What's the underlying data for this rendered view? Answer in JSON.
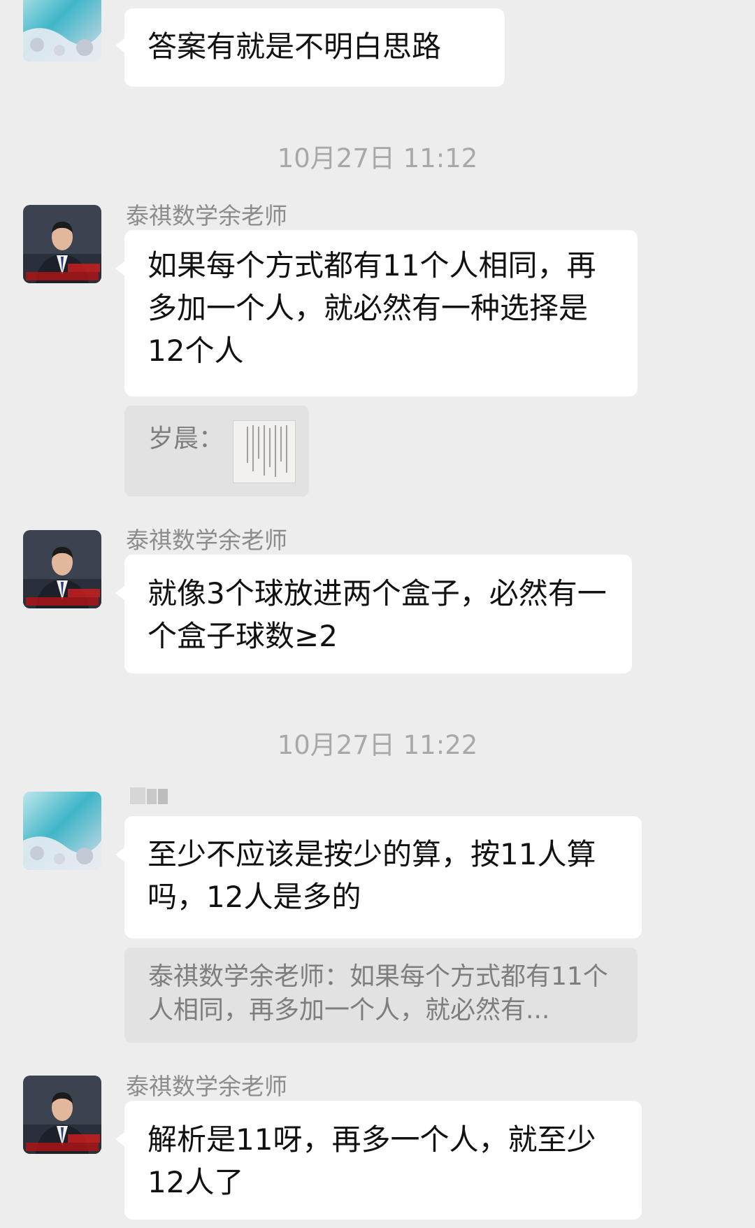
{
  "messages": [
    {
      "text": "答案有就是不明白思路"
    },
    {
      "timestamp": "10月27日 11:12"
    },
    {
      "sender": "泰祺数学余老师",
      "text": "如果每个方式都有11个人相同，再多加一个人，就必然有一种选择是12个人"
    },
    {
      "quote_label": "岁晨："
    },
    {
      "sender": "泰祺数学余老师",
      "text": "就像3个球放进两个盒子，必然有一个盒子球数≥2"
    },
    {
      "timestamp": "10月27日 11:22"
    },
    {
      "text": "至少不应该是按少的算，按11人算吗，12人是多的",
      "quote": "泰祺数学余老师：如果每个方式都有11个人相同，再多加一个人，就必然有..."
    },
    {
      "sender": "泰祺数学余老师",
      "text": "解析是11呀，再多一个人，就至少12人了"
    }
  ],
  "colors": {
    "background": "#ededed",
    "bubble": "#ffffff",
    "quote_bg": "#e2e2e2",
    "timestamp": "#a8a8a8",
    "sender": "#8c8c8c"
  }
}
